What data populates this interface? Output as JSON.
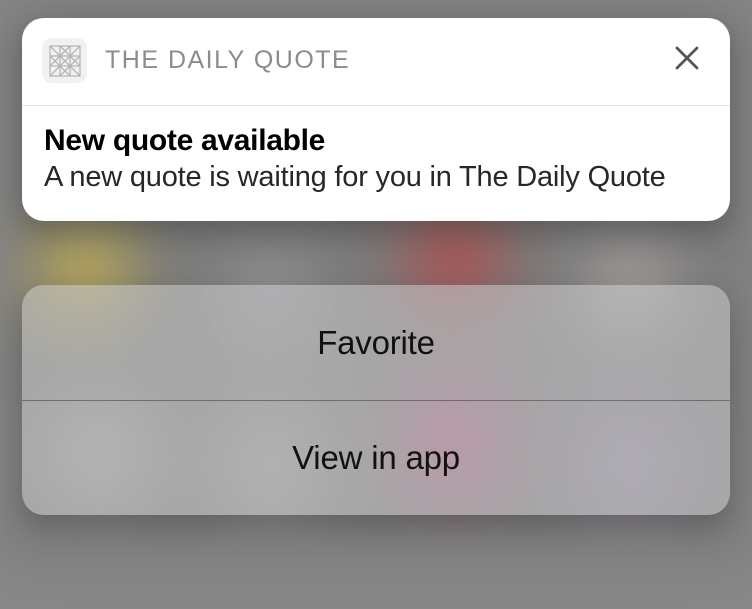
{
  "notification": {
    "app_name": "THE DAILY QUOTE",
    "title": "New quote available",
    "message": "A new quote is waiting for you in The Daily Quote"
  },
  "actions": {
    "favorite": "Favorite",
    "view_in_app": "View in app"
  }
}
